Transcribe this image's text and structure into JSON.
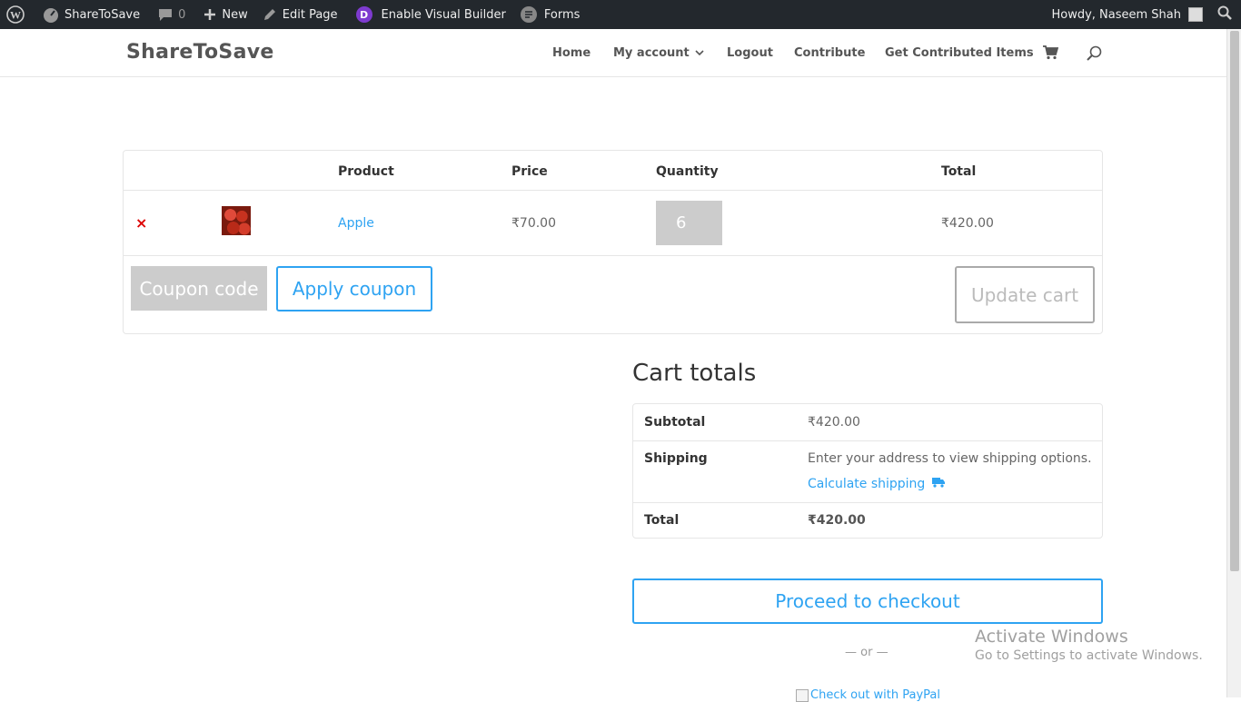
{
  "admin_bar": {
    "site_name": "ShareToSave",
    "comments_count": "0",
    "new_label": "New",
    "edit_page_label": "Edit Page",
    "visual_builder_label": "Enable Visual Builder",
    "divi_letter": "D",
    "forms_label": "Forms",
    "howdy_label": "Howdy, Naseem Shah"
  },
  "header": {
    "logo": "ShareToSave",
    "nav": {
      "home": "Home",
      "my_account": "My account",
      "logout": "Logout",
      "contribute": "Contribute",
      "get_contributed": "Get Contributed Items"
    }
  },
  "cart": {
    "headers": {
      "product": "Product",
      "price": "Price",
      "quantity": "Quantity",
      "total": "Total"
    },
    "items": [
      {
        "remove": "×",
        "name": "Apple",
        "price": "₹70.00",
        "quantity": "6",
        "total": "₹420.00"
      }
    ],
    "coupon_placeholder": "Coupon code",
    "apply_coupon_label": "Apply coupon",
    "update_cart_label": "Update cart"
  },
  "totals": {
    "title": "Cart totals",
    "subtotal_label": "Subtotal",
    "subtotal_value": "₹420.00",
    "shipping_label": "Shipping",
    "shipping_text": "Enter your address to view shipping options.",
    "calculate_shipping": "Calculate shipping",
    "total_label": "Total",
    "total_value": "₹420.00",
    "checkout_label": "Proceed to checkout",
    "or_label": "— or —",
    "paypal_alt": "Check out with PayPal"
  },
  "watermark": {
    "line1": "Activate Windows",
    "line2": "Go to Settings to activate Windows."
  },
  "colors": {
    "accent": "#2ea3f2",
    "admin_bar": "#23282d",
    "remove": "#dd0000",
    "divi": "#7e3bd0"
  }
}
